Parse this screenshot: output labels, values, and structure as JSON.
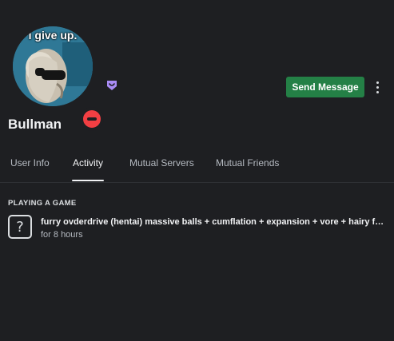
{
  "profile": {
    "avatar_caption": "i give up.",
    "status": "do-not-disturb",
    "badge_icon": "nitro-badge-icon",
    "username": "Bullman"
  },
  "actions": {
    "send_message_label": "Send Message",
    "more_icon": "more-vertical-icon"
  },
  "tabs": [
    {
      "label": "User Info",
      "active": false
    },
    {
      "label": "Activity",
      "active": true
    },
    {
      "label": "Mutual Servers",
      "active": false
    },
    {
      "label": "Mutual Friends",
      "active": false
    }
  ],
  "activity": {
    "section_title": "PLAYING A GAME",
    "game_icon_glyph": "?",
    "game_name": "furry ovderdrive (hentai) massive balls + cumflation + expansion + vore + hairy feet ...",
    "duration": "for 8 hours"
  },
  "colors": {
    "background": "#1e1f22",
    "send_button": "#248046",
    "dnd_status": "#f23f43",
    "badge": "#a98cf5"
  }
}
